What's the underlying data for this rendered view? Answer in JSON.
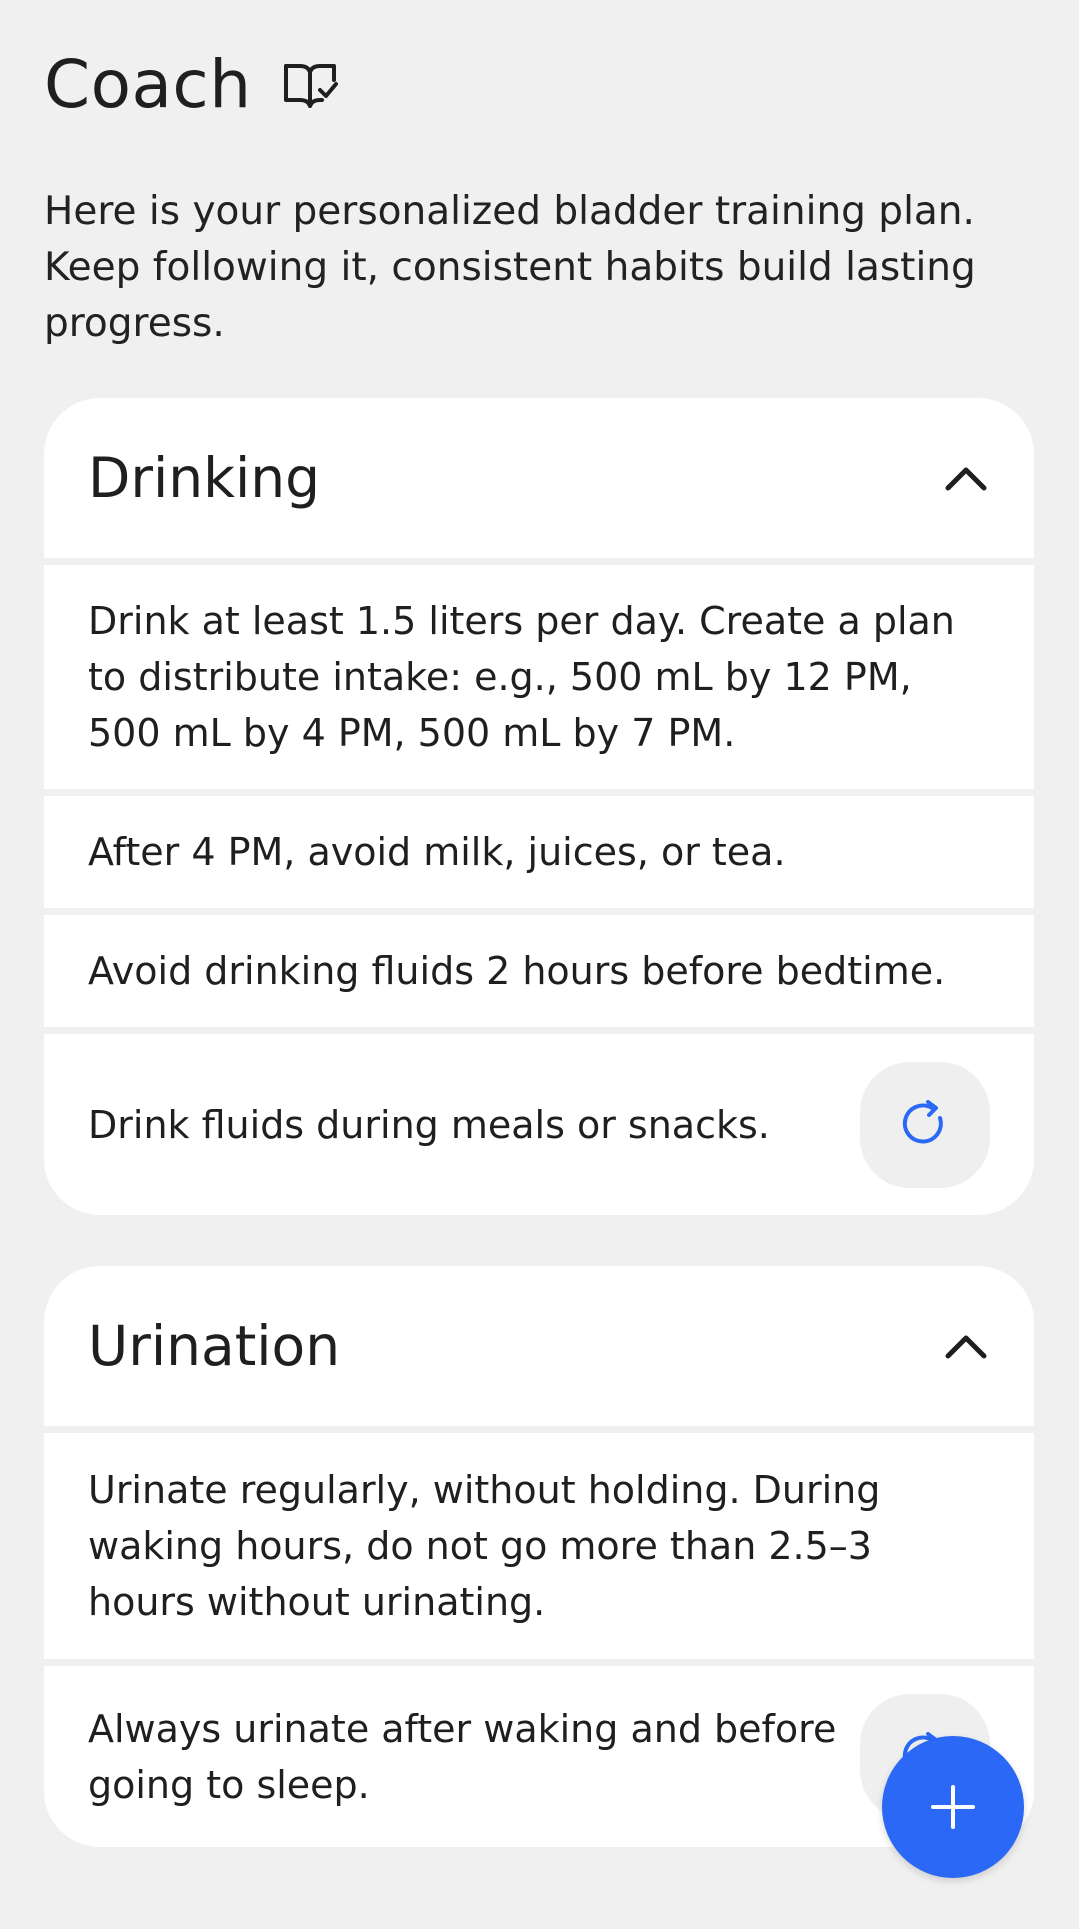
{
  "header": {
    "title": "Coach",
    "icon": "book-check-icon"
  },
  "intro": "Here is your personalized bladder training plan. Keep following it, consistent habits build lasting progress.",
  "sections": [
    {
      "title": "Drinking",
      "expanded": true,
      "items": [
        "Drink at least 1.5 liters per day. Create a plan to distribute intake: e.g., 500 mL by 12 PM, 500 mL by 4 PM, 500 mL by 7 PM.",
        "After 4 PM, avoid milk, juices, or tea.",
        "Avoid drinking fluids 2 hours before bedtime.",
        "Drink fluids during meals or snacks."
      ]
    },
    {
      "title": "Urination",
      "expanded": true,
      "items": [
        "Urinate regularly, without holding. During waking hours, do not go more than 2.5–3 hours without urinating.",
        "Always urinate after waking and before going to sleep."
      ]
    }
  ],
  "colors": {
    "accent": "#2a68f5",
    "background": "#f0f0f0",
    "card": "#ffffff"
  },
  "fab": {
    "icon": "plus-icon"
  }
}
